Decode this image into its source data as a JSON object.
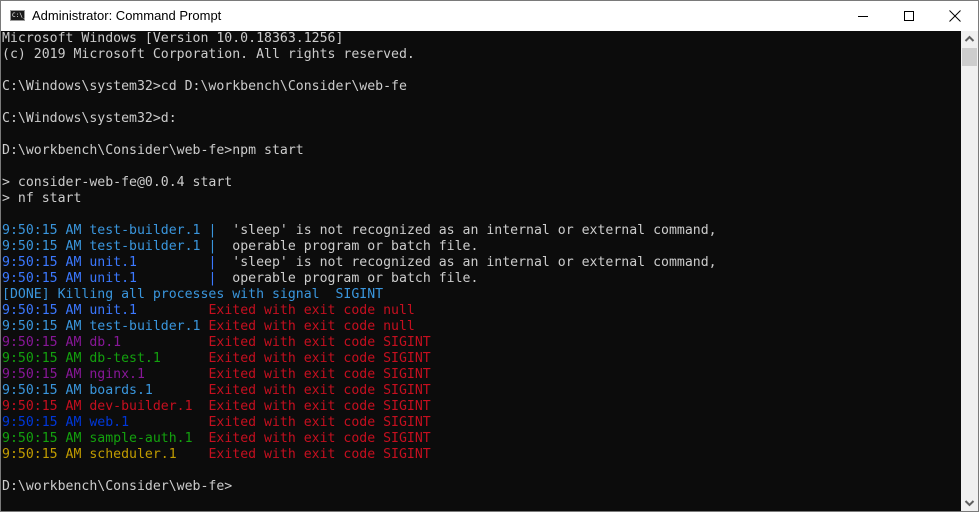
{
  "window": {
    "title": "Administrator: Command Prompt",
    "icon": "cmd-icon",
    "icon_text": "C:\\_",
    "controls": [
      "minimize",
      "maximize",
      "close"
    ]
  },
  "colors": {
    "background": "#0c0c0c",
    "default_text": "#cccccc",
    "stderr_text": "#c50f1f",
    "done_text": "#3a96dd",
    "pipe": "#3b78ff"
  },
  "console": {
    "lines": [
      {
        "segments": [
          {
            "text": "Microsoft Windows [Version 10.0.18363.1256]",
            "color": "#cccccc"
          }
        ]
      },
      {
        "segments": [
          {
            "text": "(c) 2019 Microsoft Corporation. All rights reserved.",
            "color": "#cccccc"
          }
        ]
      },
      {
        "segments": []
      },
      {
        "segments": [
          {
            "text": "C:\\Windows\\system32>cd D:\\workbench\\Consider\\web-fe",
            "color": "#cccccc"
          }
        ]
      },
      {
        "segments": []
      },
      {
        "segments": [
          {
            "text": "C:\\Windows\\system32>d:",
            "color": "#cccccc"
          }
        ]
      },
      {
        "segments": []
      },
      {
        "segments": [
          {
            "text": "D:\\workbench\\Consider\\web-fe>npm start",
            "color": "#cccccc"
          }
        ]
      },
      {
        "segments": []
      },
      {
        "segments": [
          {
            "text": "> consider-web-fe@0.0.4 start",
            "color": "#cccccc"
          }
        ]
      },
      {
        "segments": [
          {
            "text": "> nf start",
            "color": "#cccccc"
          }
        ]
      },
      {
        "segments": []
      },
      {
        "segments": [
          {
            "text": "9:50:15 AM test-builder.1 ",
            "color": "#3a96dd"
          },
          {
            "text": "|",
            "color": "#3a96dd"
          },
          {
            "text": "  'sleep' is not recognized as an internal or external command,",
            "color": "#cccccc"
          }
        ]
      },
      {
        "segments": [
          {
            "text": "9:50:15 AM test-builder.1 ",
            "color": "#3a96dd"
          },
          {
            "text": "|",
            "color": "#3a96dd"
          },
          {
            "text": "  operable program or batch file.",
            "color": "#cccccc"
          }
        ]
      },
      {
        "segments": [
          {
            "text": "9:50:15 AM unit.1         ",
            "color": "#3b78ff"
          },
          {
            "text": "|",
            "color": "#3b78ff"
          },
          {
            "text": "  'sleep' is not recognized as an internal or external command,",
            "color": "#cccccc"
          }
        ]
      },
      {
        "segments": [
          {
            "text": "9:50:15 AM unit.1         ",
            "color": "#3b78ff"
          },
          {
            "text": "|",
            "color": "#3b78ff"
          },
          {
            "text": "  operable program or batch file.",
            "color": "#cccccc"
          }
        ]
      },
      {
        "segments": [
          {
            "text": "[DONE] Killing all processes with signal  SIGINT",
            "color": "#3a96dd"
          }
        ]
      },
      {
        "segments": [
          {
            "text": "9:50:15 AM unit.1         ",
            "color": "#3b78ff"
          },
          {
            "text": "Exited with exit code null",
            "color": "#c50f1f"
          }
        ]
      },
      {
        "segments": [
          {
            "text": "9:50:15 AM test-builder.1 ",
            "color": "#3a96dd"
          },
          {
            "text": "Exited with exit code null",
            "color": "#c50f1f"
          }
        ]
      },
      {
        "segments": [
          {
            "text": "9:50:15 AM db.1           ",
            "color": "#881798"
          },
          {
            "text": "Exited with exit code SIGINT",
            "color": "#c50f1f"
          }
        ]
      },
      {
        "segments": [
          {
            "text": "9:50:15 AM db-test.1      ",
            "color": "#13a10e"
          },
          {
            "text": "Exited with exit code SIGINT",
            "color": "#c50f1f"
          }
        ]
      },
      {
        "segments": [
          {
            "text": "9:50:15 AM nginx.1        ",
            "color": "#881798"
          },
          {
            "text": "Exited with exit code SIGINT",
            "color": "#c50f1f"
          }
        ]
      },
      {
        "segments": [
          {
            "text": "9:50:15 AM boards.1       ",
            "color": "#3a96dd"
          },
          {
            "text": "Exited with exit code SIGINT",
            "color": "#c50f1f"
          }
        ]
      },
      {
        "segments": [
          {
            "text": "9:50:15 AM dev-builder.1  ",
            "color": "#c50f1f"
          },
          {
            "text": "Exited with exit code SIGINT",
            "color": "#c50f1f"
          }
        ]
      },
      {
        "segments": [
          {
            "text": "9:50:15 AM web.1          ",
            "color": "#0037da"
          },
          {
            "text": "Exited with exit code SIGINT",
            "color": "#c50f1f"
          }
        ]
      },
      {
        "segments": [
          {
            "text": "9:50:15 AM sample-auth.1  ",
            "color": "#13a10e"
          },
          {
            "text": "Exited with exit code SIGINT",
            "color": "#c50f1f"
          }
        ]
      },
      {
        "segments": [
          {
            "text": "9:50:15 AM scheduler.1    ",
            "color": "#c19c00"
          },
          {
            "text": "Exited with exit code SIGINT",
            "color": "#c50f1f"
          }
        ]
      },
      {
        "segments": []
      },
      {
        "segments": [
          {
            "text": "D:\\workbench\\Consider\\web-fe>",
            "color": "#cccccc"
          }
        ]
      }
    ]
  },
  "scrollbar": {
    "up_icon": "chevron-up-icon",
    "down_icon": "chevron-down-icon",
    "position": 0
  }
}
